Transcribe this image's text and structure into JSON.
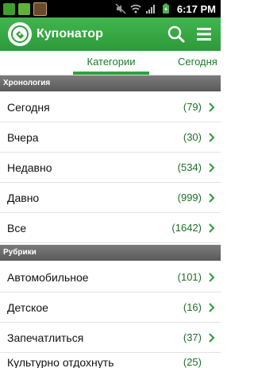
{
  "status_bar": {
    "time": "6:17 PM",
    "icons": [
      "app-icon-green",
      "app-icon-green",
      "image-icon",
      "mute-icon",
      "wifi-icon",
      "signal-icon",
      "battery-icon"
    ]
  },
  "action_bar": {
    "title": "Купонатор",
    "accent": "#37ab45"
  },
  "tabs": [
    {
      "label": "Категории",
      "active": true
    },
    {
      "label": "Сегодня",
      "active": false
    }
  ],
  "sections": [
    {
      "title": "Хронология",
      "items": [
        {
          "label": "Сегодня",
          "count": "(79)"
        },
        {
          "label": "Вчера",
          "count": "(30)"
        },
        {
          "label": "Недавно",
          "count": "(534)"
        },
        {
          "label": "Давно",
          "count": "(999)"
        },
        {
          "label": "Все",
          "count": "(1642)"
        }
      ]
    },
    {
      "title": "Рубрики",
      "items": [
        {
          "label": "Автомобильное",
          "count": "(101)"
        },
        {
          "label": "Детское",
          "count": "(16)"
        },
        {
          "label": "Запечатлиться",
          "count": "(37)"
        },
        {
          "label": "Культурно отдохнуть",
          "count": "(25)"
        }
      ]
    }
  ]
}
